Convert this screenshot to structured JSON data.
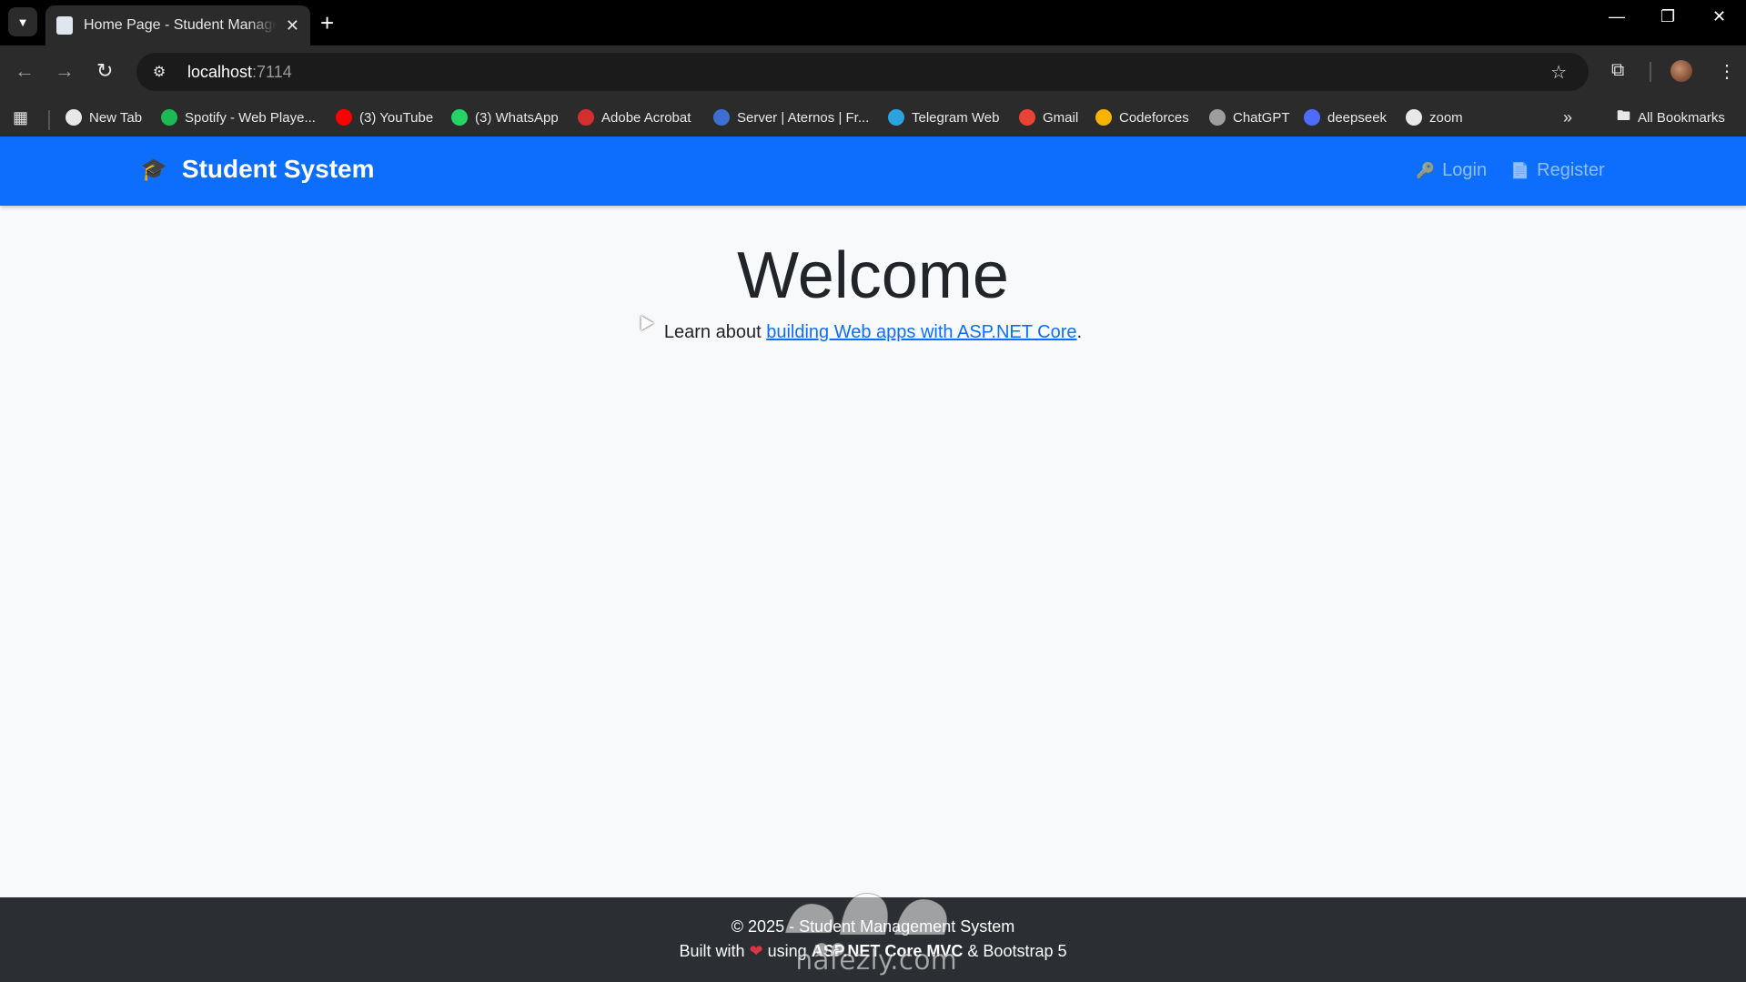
{
  "browser": {
    "tab_title": "Home Page - Student Management System",
    "url_host": "localhost",
    "url_port": ":7114",
    "bookmarks": [
      {
        "label": "New Tab",
        "color": "#e8e8e8"
      },
      {
        "label": "Spotify - Web Playe...",
        "color": "#1db954"
      },
      {
        "label": "(3) YouTube",
        "color": "#ff0000"
      },
      {
        "label": "(3) WhatsApp",
        "color": "#25d366"
      },
      {
        "label": "Adobe Acrobat",
        "color": "#d32f2f"
      },
      {
        "label": "Server | Aternos | Fr...",
        "color": "#3d6fd1"
      },
      {
        "label": "Telegram Web",
        "color": "#2aa3e0"
      },
      {
        "label": "Gmail",
        "color": "#ea4335"
      },
      {
        "label": "Codeforces",
        "color": "#f4b400"
      },
      {
        "label": "ChatGPT",
        "color": "#9e9e9e"
      },
      {
        "label": "deepseek",
        "color": "#4d6bfe"
      },
      {
        "label": "zoom",
        "color": "#e8e8e8"
      }
    ],
    "all_bookmarks": "All Bookmarks"
  },
  "navbar": {
    "brand": "Student System",
    "login": "Login",
    "register": "Register",
    "color": "#0d6efd"
  },
  "main": {
    "heading": "Welcome",
    "learn_prefix": "Learn about ",
    "learn_link": "building Web apps with ASP.NET Core",
    "learn_suffix": "."
  },
  "footer": {
    "line1": "© 2025 - Student Management System",
    "built_prefix": "Built with",
    "built_middle": "using",
    "built_tech": "ASP.NET Core MVC",
    "built_suffix": "& Bootstrap 5"
  },
  "watermark": {
    "domain": "nafezly.com"
  }
}
